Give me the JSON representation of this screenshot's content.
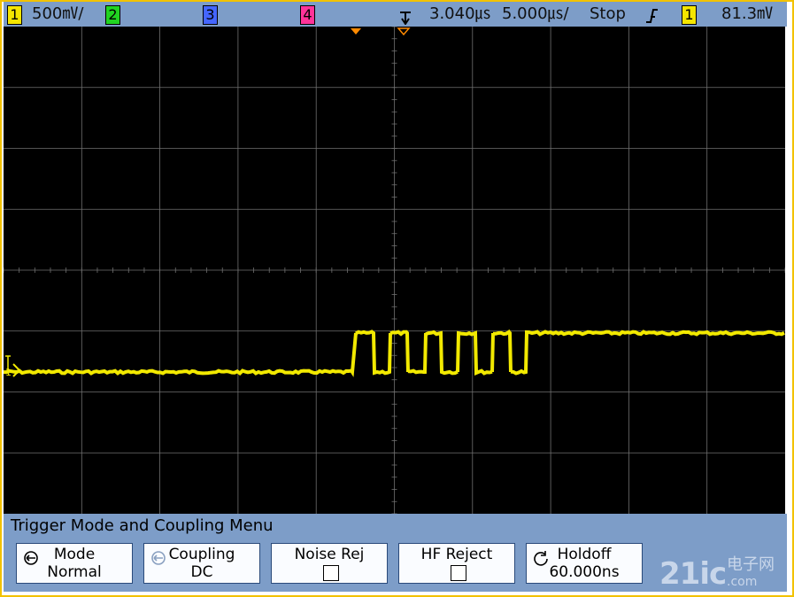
{
  "status_bar": {
    "ch1_label": "1",
    "ch1_scale": "500㎷/",
    "ch2_label": "2",
    "ch3_label": "3",
    "ch4_label": "4",
    "time_delay": "3.040㎲",
    "time_scale": "5.000㎲/",
    "run_state": "Stop",
    "trigger_slope_icon": "rising-edge-icon",
    "trigger_source": "1",
    "trigger_level": "81.3㎷",
    "colors": {
      "ch1": "#f5e600",
      "ch2": "#21d321",
      "ch3": "#4466ff",
      "ch4": "#ff3399"
    }
  },
  "screen": {
    "channel_marker": "1",
    "trace_color": "#f2e900",
    "grid_color": "#707070"
  },
  "menu": {
    "title": "Trigger Mode and Coupling Menu",
    "softkeys": [
      {
        "line1": "Mode",
        "line2": "Normal",
        "icon": "rotary-select-icon"
      },
      {
        "line1": "Coupling",
        "line2": "DC",
        "icon": "rotary-select-icon"
      },
      {
        "line1": "Noise Rej",
        "line2": ""
      },
      {
        "line1": "HF Reject",
        "line2": ""
      },
      {
        "line1": "Holdoff",
        "line2": "60.000ns",
        "icon": "rotary-adjust-icon"
      }
    ]
  },
  "watermark": {
    "brand": "21ic",
    "cn_text": "电子网",
    "suffix": ".com"
  }
}
